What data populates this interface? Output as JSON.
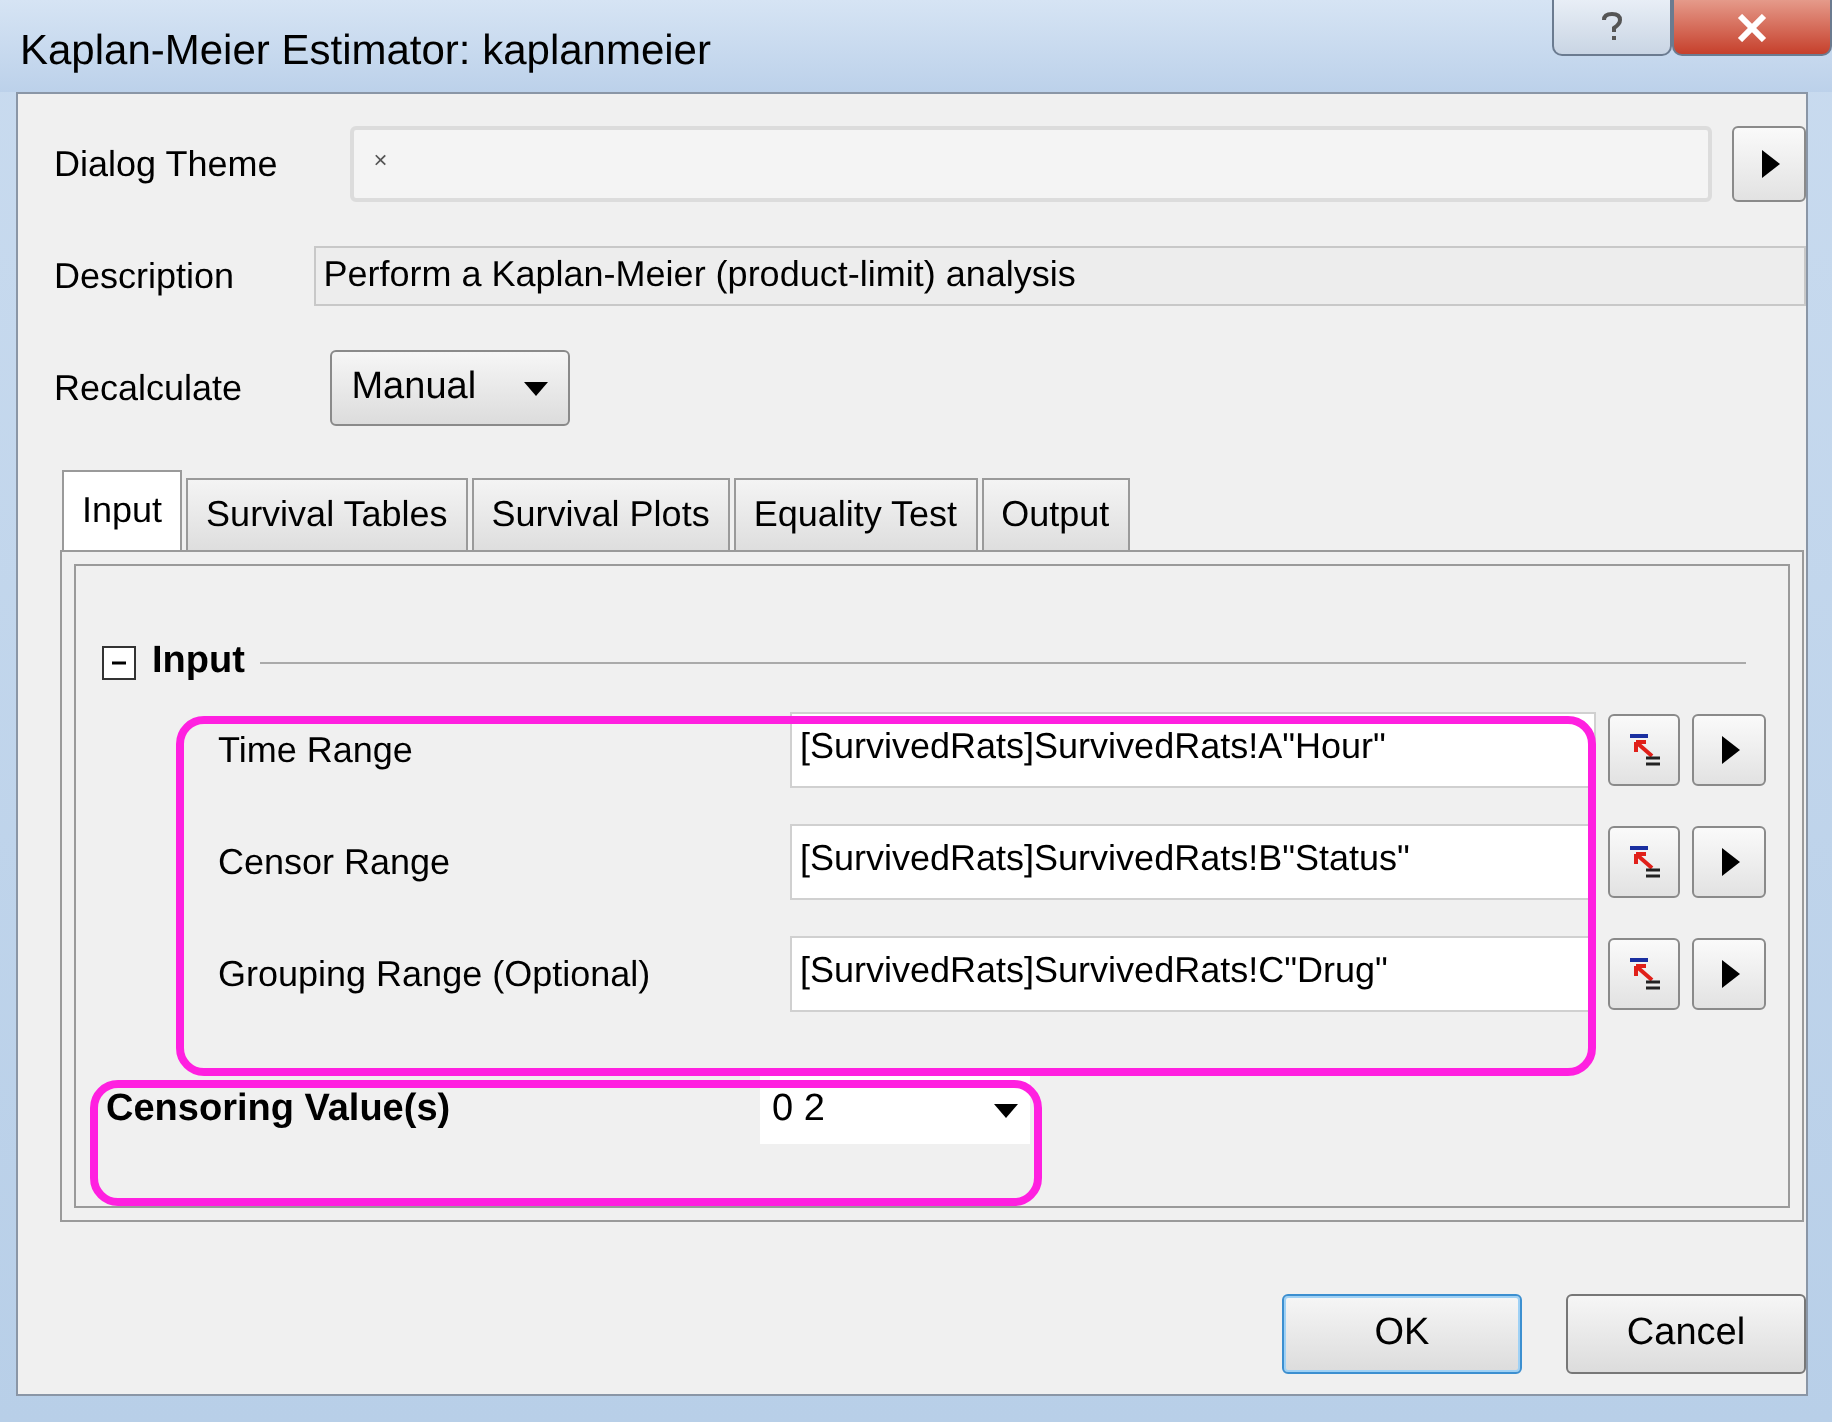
{
  "window": {
    "title": "Kaplan-Meier Estimator: kaplanmeier"
  },
  "dialog_theme": {
    "label": "Dialog Theme",
    "value": "×"
  },
  "description": {
    "label": "Description",
    "value": "Perform a Kaplan-Meier (product-limit) analysis"
  },
  "recalculate": {
    "label": "Recalculate",
    "value": "Manual"
  },
  "tabs": [
    {
      "label": "Input",
      "selected": true
    },
    {
      "label": "Survival Tables",
      "selected": false
    },
    {
      "label": "Survival Plots",
      "selected": false
    },
    {
      "label": "Equality Test",
      "selected": false
    },
    {
      "label": "Output",
      "selected": false
    }
  ],
  "section": {
    "label": "Input",
    "expanded": true
  },
  "ranges": [
    {
      "label": "Time Range",
      "value": "[SurvivedRats]SurvivedRats!A\"Hour\""
    },
    {
      "label": "Censor Range",
      "value": "[SurvivedRats]SurvivedRats!B\"Status\""
    },
    {
      "label": "Grouping Range (Optional)",
      "value": "[SurvivedRats]SurvivedRats!C\"Drug\""
    }
  ],
  "censoring": {
    "label": "Censoring Value(s)",
    "value": "0 2"
  },
  "buttons": [
    {
      "label": "OK",
      "kind": "default"
    },
    {
      "label": "Cancel",
      "kind": "normal"
    }
  ]
}
